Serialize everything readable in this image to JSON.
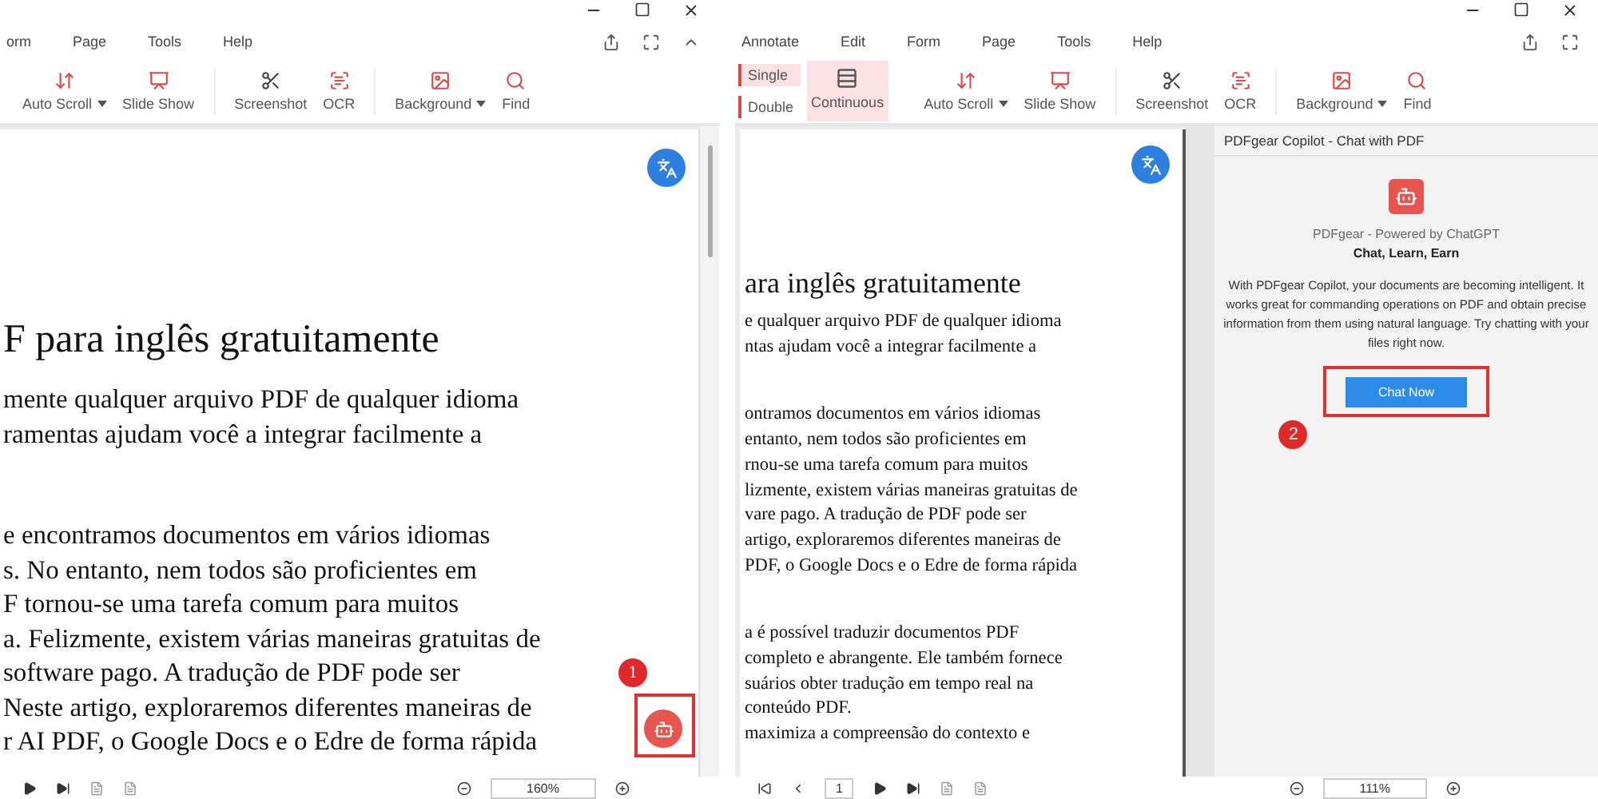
{
  "panes": [
    {
      "menu": [
        "orm",
        "Page",
        "Tools",
        "Help"
      ],
      "toolbar": [
        [
          {
            "kind": "auto-scroll",
            "label": "Auto Scroll",
            "dropdown": true
          },
          {
            "kind": "slide-show",
            "label": "Slide Show",
            "dropdown": false
          }
        ],
        [
          {
            "kind": "screenshot",
            "label": "Screenshot",
            "dropdown": false
          },
          {
            "kind": "ocr",
            "label": "OCR",
            "dropdown": false
          }
        ],
        [
          {
            "kind": "background",
            "label": "Background",
            "dropdown": true
          },
          {
            "kind": "find",
            "label": "Find",
            "dropdown": false
          }
        ]
      ],
      "document": {
        "heading": "F para inglês gratuitamente",
        "paragraphs": [
          [
            "mente qualquer arquivo PDF de qualquer idioma",
            "ramentas ajudam você a integrar facilmente a"
          ],
          [
            "e encontramos documentos em vários idiomas",
            "s. No entanto, nem todos são proficientes em",
            "F tornou-se uma tarefa comum para muitos",
            "a. Felizmente, existem várias maneiras gratuitas de",
            " software pago. A tradução de PDF pode ser",
            "Neste artigo, exploraremos diferentes maneiras de",
            "r AI PDF, o Google Docs e o Edre de forma rápida"
          ]
        ]
      },
      "copilot_callout": "1",
      "bottom_bar": {
        "zoom": "160%"
      }
    },
    {
      "menu": [
        "Annotate",
        "Edit",
        "Form",
        "Page",
        "Tools",
        "Help"
      ],
      "view_modes": [
        {
          "label": "Single",
          "selected": true
        },
        {
          "label": "Double",
          "selected": false
        }
      ],
      "continuous": {
        "label": "Continuous",
        "selected": true
      },
      "toolbar": [
        [
          {
            "kind": "auto-scroll",
            "label": "Auto Scroll",
            "dropdown": true
          },
          {
            "kind": "slide-show",
            "label": "Slide Show",
            "dropdown": false
          }
        ],
        [
          {
            "kind": "screenshot",
            "label": "Screenshot",
            "dropdown": false
          },
          {
            "kind": "ocr",
            "label": "OCR",
            "dropdown": false
          }
        ],
        [
          {
            "kind": "background",
            "label": "Background",
            "dropdown": true
          },
          {
            "kind": "find",
            "label": "Find",
            "dropdown": false
          }
        ]
      ],
      "document": {
        "heading": "ara inglês gratuitamente",
        "paragraphs": [
          [
            "e qualquer arquivo PDF de qualquer idioma",
            "ntas ajudam você a integrar facilmente a"
          ],
          [
            "ontramos documentos em vários idiomas",
            " entanto, nem todos são proficientes em",
            "rnou-se uma tarefa comum para muitos",
            "lizmente, existem várias maneiras gratuitas de",
            "vare pago. A tradução de PDF pode ser",
            " artigo, exploraremos diferentes maneiras de",
            "PDF, o Google Docs e o Edre de forma rápida"
          ],
          [
            "a é possível traduzir documentos PDF",
            " completo e abrangente. Ele também fornece",
            "suários obter tradução em tempo real na",
            " conteúdo PDF.",
            " maximiza a compreensão do contexto e"
          ]
        ]
      },
      "copilot_panel": {
        "title": "PDFgear Copilot - Chat with PDF",
        "subtitle": "PDFgear - Powered by ChatGPT",
        "tagline": "Chat, Learn, Earn",
        "description": "With PDFgear Copilot, your documents are becoming intelligent. It works great for commanding operations on PDF and obtain precise information from them using natural language. Try chatting with your files right now.",
        "button": "Chat Now",
        "callout": "2"
      },
      "bottom_bar": {
        "page": "1",
        "zoom": "111%"
      }
    }
  ]
}
